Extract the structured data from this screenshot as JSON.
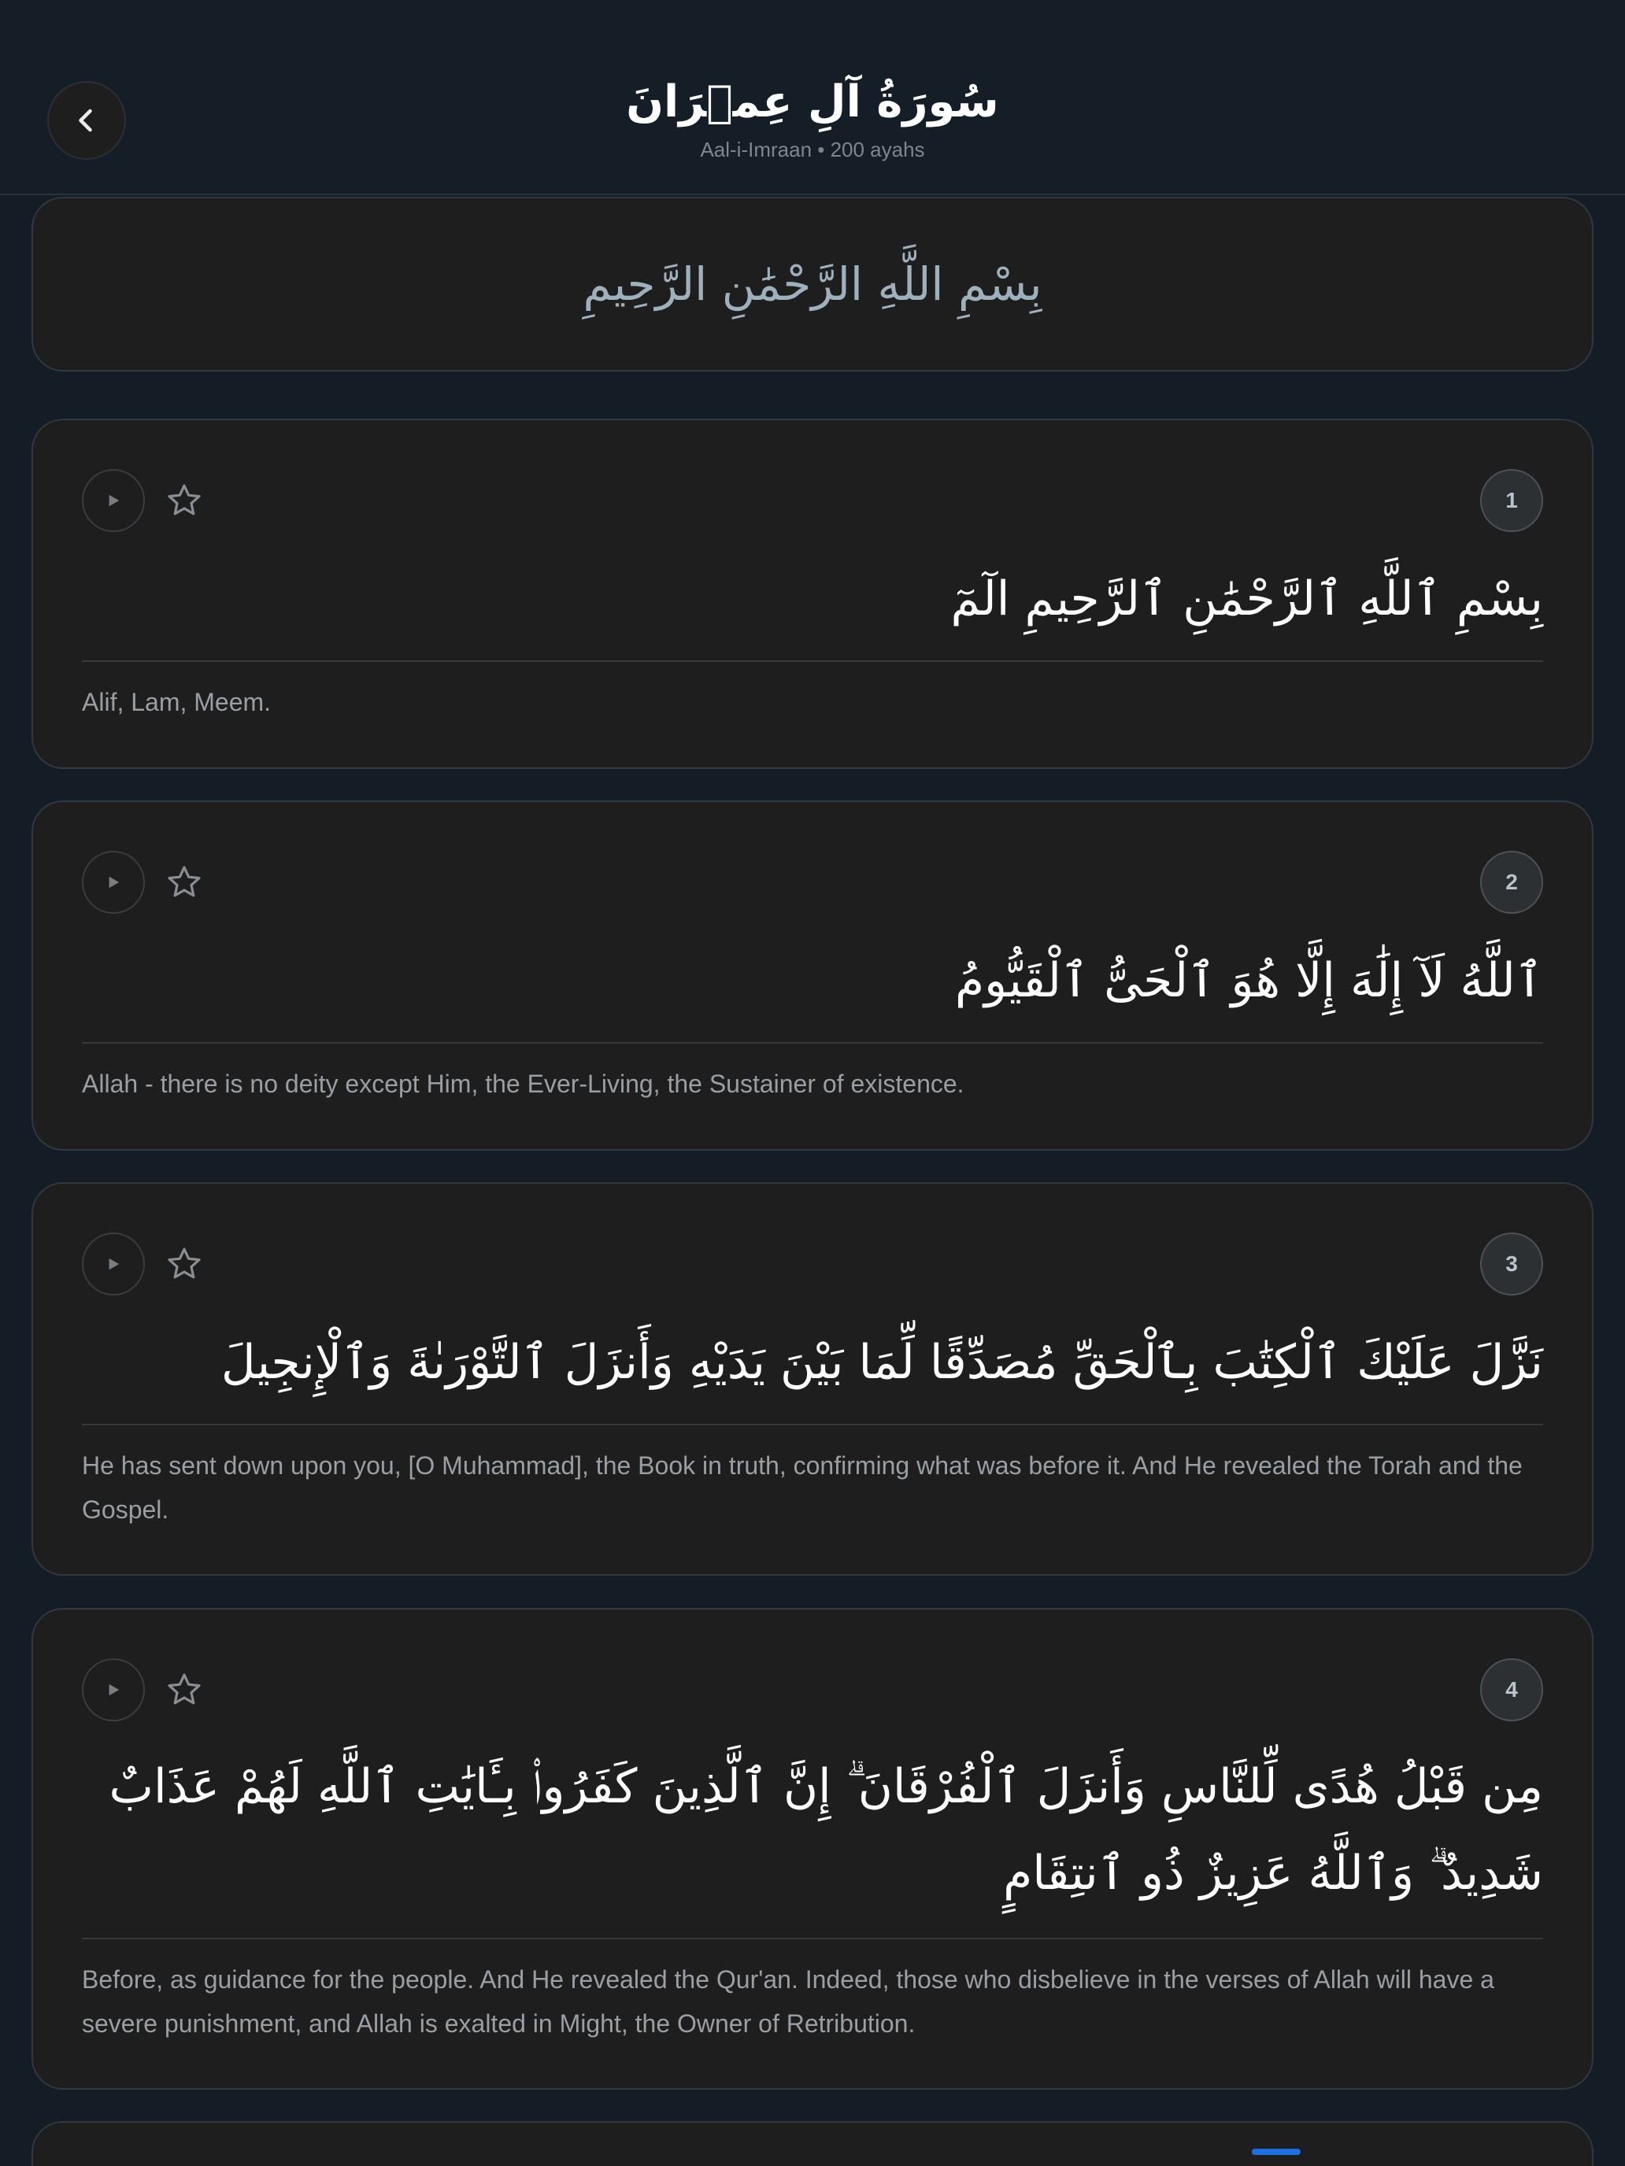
{
  "header": {
    "title": "سُورَةُ آلِ عِمۡرَانَ",
    "subtitle": "Aal-i-Imraan • 200 ayahs"
  },
  "bismillah": "بِسْمِ اللَّهِ الرَّحْمَٰنِ الرَّحِيمِ",
  "ayahs": [
    {
      "number": "1",
      "arabic": "بِسْمِ ٱللَّهِ ٱلرَّحْمَٰنِ ٱلرَّحِيمِ الٓمٓ",
      "translation": "Alif, Lam, Meem."
    },
    {
      "number": "2",
      "arabic": "ٱللَّهُ لَآ إِلَٰهَ إِلَّا هُوَ ٱلْحَىُّ ٱلْقَيُّومُ",
      "translation": "Allah - there is no deity except Him, the Ever-Living, the Sustainer of existence."
    },
    {
      "number": "3",
      "arabic": "نَزَّلَ عَلَيْكَ ٱلْكِتَٰبَ بِٱلْحَقِّ مُصَدِّقًا لِّمَا بَيْنَ يَدَيْهِ وَأَنزَلَ ٱلتَّوْرَىٰةَ وَٱلْإِنجِيلَ",
      "translation": "He has sent down upon you, [O Muhammad], the Book in truth, confirming what was before it. And He revealed the Torah and the Gospel."
    },
    {
      "number": "4",
      "arabic": "مِن قَبْلُ هُدًى لِّلنَّاسِ وَأَنزَلَ ٱلْفُرْقَانَ ۗ إِنَّ ٱلَّذِينَ كَفَرُوا۟ بِـَٔايَٰتِ ٱللَّهِ لَهُمْ عَذَابٌ شَدِيدٌ ۗ وَٱللَّهُ عَزِيزٌ ذُو ٱنتِقَامٍ",
      "translation": "Before, as guidance for the people. And He revealed the Qur'an. Indeed, those who disbelieve in the verses of Allah will have a severe punishment, and Allah is exalted in Might, the Owner of Retribution."
    }
  ],
  "icons": {
    "back": "chevron-left-icon",
    "play": "play-icon",
    "star": "star-outline-icon"
  },
  "colors": {
    "background": "#141c25",
    "card": "#1e1e1e",
    "accent": "#1f6fe0"
  }
}
